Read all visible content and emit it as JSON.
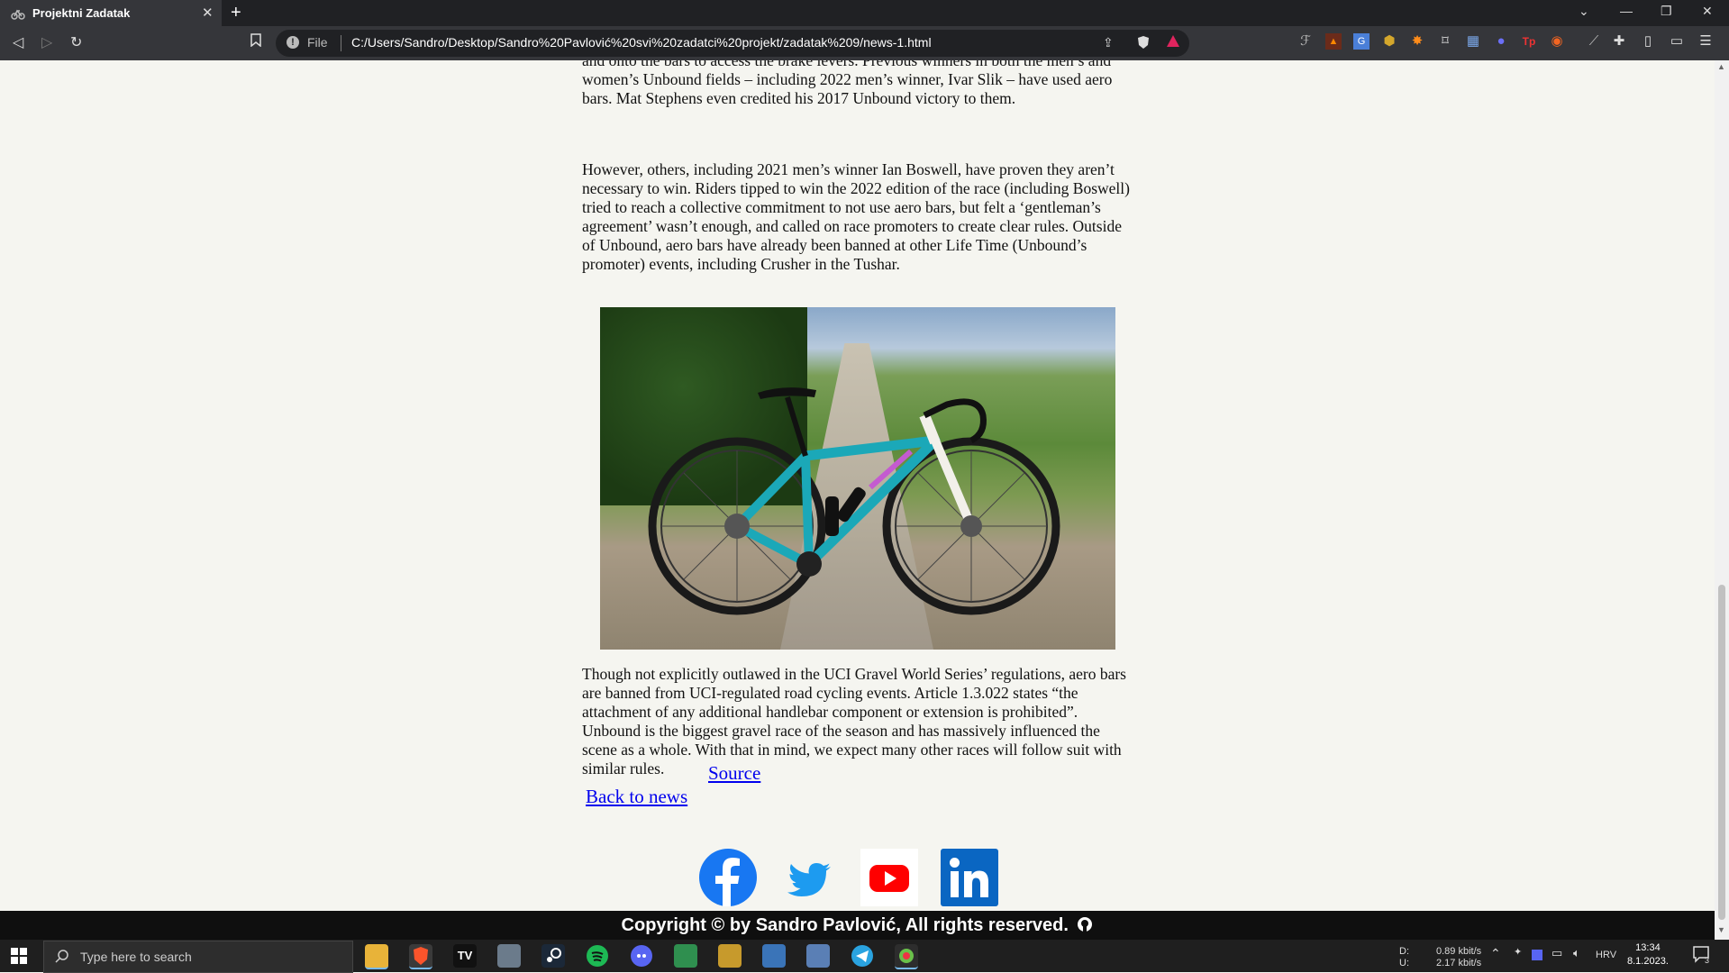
{
  "browser": {
    "tab_title": "Projektni Zadatak",
    "tab_close": "✕",
    "new_tab": "+",
    "url_scheme": "File",
    "url": "C:/Users/Sandro/Desktop/Sandro%20Pavlović%20svi%20zadatci%20projekt/zadatak%209/news-1.html"
  },
  "article": {
    "para1": "and onto the bars to access the brake levers. Previous winners in both the men’s and women’s Unbound fields – including 2022 men’s winner, Ivar Slik – have used aero bars. Mat Stephens even credited his 2017 Unbound victory to them.",
    "para2": "However, others, including 2021 men’s winner Ian Boswell, have proven they aren’t necessary to win. Riders tipped to win the 2022 edition of the race (including Boswell) tried to reach a collective commitment to not use aero bars, but felt a ‘gentleman’s agreement’ wasn’t enough, and called on race promoters to create clear rules. Outside of Unbound, aero bars have already been banned at other Life Time (Unbound’s promoter) events, including Crusher in the Tushar.",
    "para3": "Though not explicitly outlawed in the UCI Gravel World Series’ regulations, aero bars are banned from UCI-regulated road cycling events. Article 1.3.022 states “the attachment of any additional handlebar component or extension is prohibited”. Unbound is the biggest gravel race of the season and has massively influenced the scene as a whole. With that in mind, we expect many other races will follow suit with similar rules.",
    "source_link": "Source",
    "back_link": "Back to news"
  },
  "footer": {
    "copyright": "Copyright © by Sandro Pavlović, All rights reserved."
  },
  "taskbar": {
    "search_placeholder": "Type here to search",
    "net_drive": "D:",
    "net_upload": "U:",
    "net_down_rate": "0.89 kbit/s",
    "net_up_rate": "2.17 kbit/s",
    "lang": "HRV",
    "time": "13:34",
    "date": "8.1.2023.",
    "notif_count": "3"
  },
  "colors": {
    "link": "#0000ee",
    "facebook": "#1877f2",
    "twitter": "#1d9bf0",
    "youtube": "#ff0000",
    "linkedin": "#0a66c2"
  }
}
